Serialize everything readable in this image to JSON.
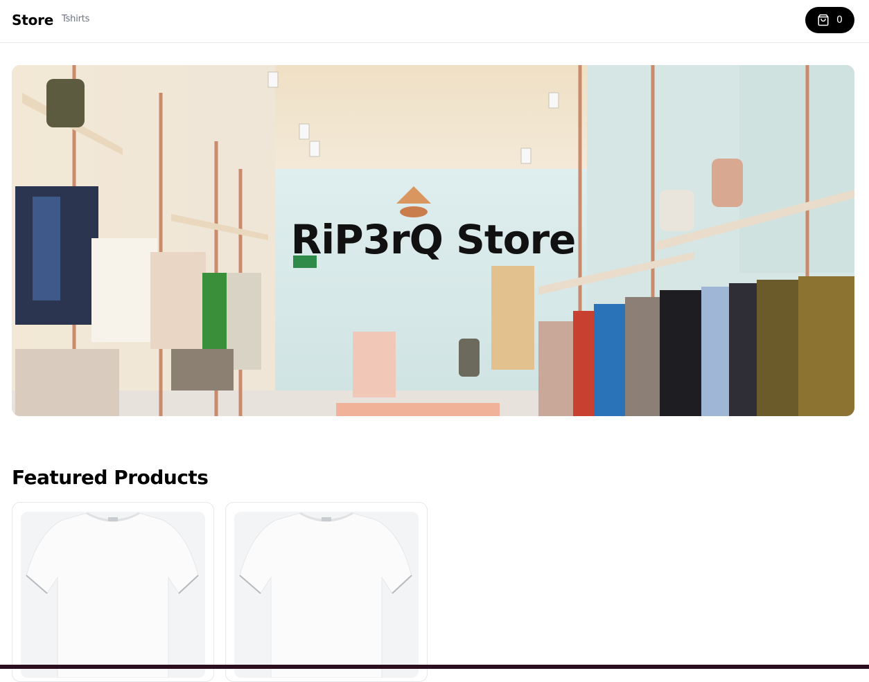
{
  "navbar": {
    "brand": "Store",
    "links": [
      {
        "label": "Tshirts"
      }
    ],
    "cart": {
      "icon": "shopping-bag-icon",
      "count": "0"
    }
  },
  "billboard": {
    "label": "RiP3rQ Store"
  },
  "featured": {
    "title": "Featured Products",
    "products": [
      {
        "image": "white-tshirt"
      },
      {
        "image": "white-tshirt"
      }
    ]
  },
  "colors": {
    "accent": "#000000",
    "muted_text": "#6b7280",
    "border": "#e5e7eb",
    "card_image_bg": "#f3f4f6"
  }
}
